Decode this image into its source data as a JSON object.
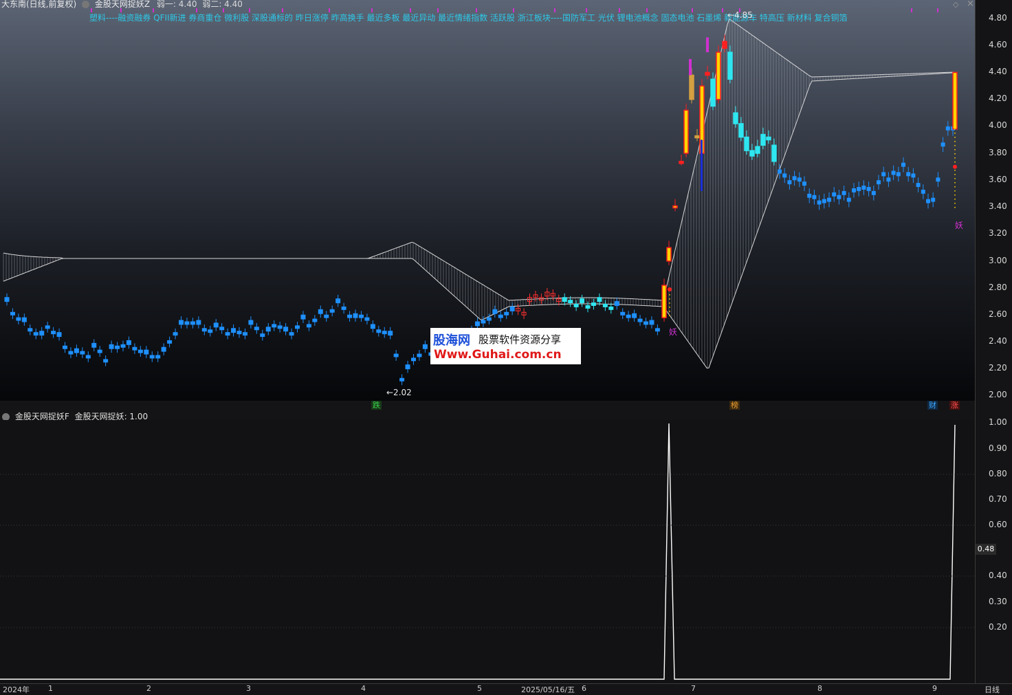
{
  "header": {
    "stock_name": "大东南(日线,前复权)",
    "indicator_name": "金股天网捉妖Z",
    "line1_label": "弱一: 4.40",
    "line2_label": "弱二: 4.40"
  },
  "concepts_text": "塑料----融资融券  QFII新进  券商重仓  微利股  深股通标的  昨日涨停  昨高换手  最近多板  最近异动  最近情绪指数  活跃股  浙江板块----国防军工  光伏  锂电池概念  固态电池  石墨烯  新能源车  特高压  新材料  复合铜箔",
  "main_axis_ticks": [
    "4.80",
    "4.60",
    "4.40",
    "4.20",
    "4.00",
    "3.80",
    "3.60",
    "3.40",
    "3.20",
    "3.00",
    "2.80",
    "2.60",
    "2.40",
    "2.20",
    "2.00"
  ],
  "annotations": {
    "low_label": "←2.02",
    "high_label": "←4.85",
    "yao_label": "妖"
  },
  "markers": [
    {
      "text": "跌",
      "color": "#3ad14c",
      "bg": "#183818"
    },
    {
      "text": "榜",
      "color": "#f0a030",
      "bg": "#3a2a10"
    },
    {
      "text": "财",
      "color": "#3fa8ff",
      "bg": "#102a44"
    },
    {
      "text": "涨",
      "color": "#ff5050",
      "bg": "#441010"
    }
  ],
  "sub_header": {
    "indicator": "金股天网捉妖F",
    "value_label": "金股天网捉妖: 1.00"
  },
  "sub_axis_ticks": [
    "1.00",
    "0.90",
    "0.80",
    "0.70",
    "0.60",
    "0.40",
    "0.30",
    "0.20"
  ],
  "current_value": "0.48",
  "bottom_dates": [
    "2024年",
    "1",
    "2",
    "3",
    "4",
    "5",
    "2025/05/16/五",
    "6",
    "7",
    "8",
    "9"
  ],
  "bottom_right_label": "日线",
  "watermark": {
    "brand": "股海网",
    "slogan": "股票软件资源分享",
    "url": "Www.Guhai.com.cn"
  },
  "colors": {
    "up_candle": "#ff3030",
    "down_candle": "#1e90ff",
    "cyan_candle": "#2ee6f0",
    "limit_up": "#ffd400",
    "envelope": "#c8c8c8",
    "concepts": "#2ec7e6",
    "yao_marker": "#d030d0"
  }
}
